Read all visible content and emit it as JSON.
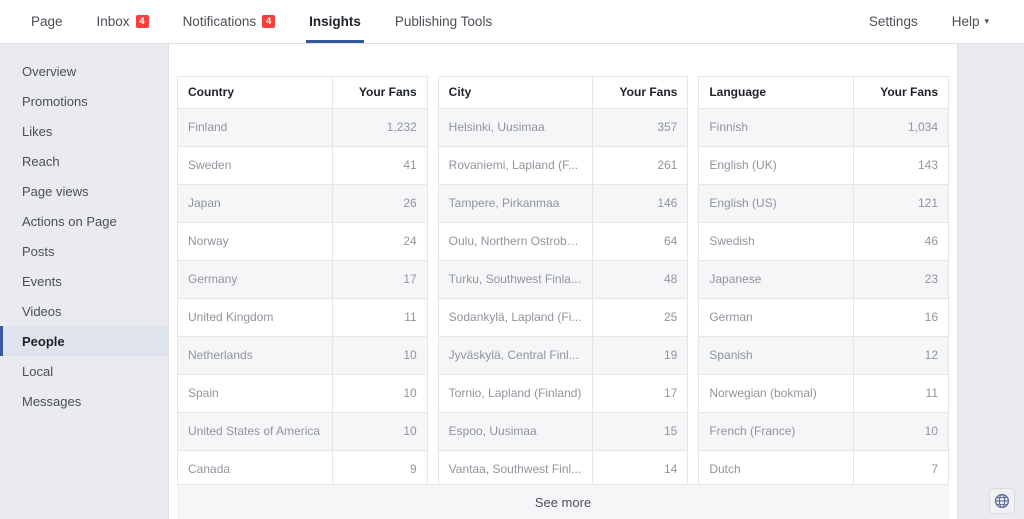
{
  "topnav": {
    "left_items": [
      {
        "label": "Page",
        "badge": null,
        "active": false,
        "caret": false
      },
      {
        "label": "Inbox",
        "badge": "4",
        "active": false,
        "caret": false
      },
      {
        "label": "Notifications",
        "badge": "4",
        "active": false,
        "caret": false
      },
      {
        "label": "Insights",
        "badge": null,
        "active": true,
        "caret": false
      },
      {
        "label": "Publishing Tools",
        "badge": null,
        "active": false,
        "caret": false
      }
    ],
    "right_items": [
      {
        "label": "Settings",
        "badge": null,
        "active": false,
        "caret": false
      },
      {
        "label": "Help",
        "badge": null,
        "active": false,
        "caret": true
      }
    ],
    "accent_color": "#365899",
    "badge_color": "#fa3e3e"
  },
  "sidebar": {
    "items": [
      {
        "label": "Overview",
        "selected": false
      },
      {
        "label": "Promotions",
        "selected": false
      },
      {
        "label": "Likes",
        "selected": false
      },
      {
        "label": "Reach",
        "selected": false
      },
      {
        "label": "Page views",
        "selected": false
      },
      {
        "label": "Actions on Page",
        "selected": false
      },
      {
        "label": "Posts",
        "selected": false
      },
      {
        "label": "Events",
        "selected": false
      },
      {
        "label": "Videos",
        "selected": false
      },
      {
        "label": "People",
        "selected": true
      },
      {
        "label": "Local",
        "selected": false
      },
      {
        "label": "Messages",
        "selected": false
      }
    ],
    "selected_marker_color": "#3b5998",
    "selected_bg_color": "#dfe3ee"
  },
  "tables": [
    {
      "id": "country",
      "headers": [
        "Country",
        "Your Fans"
      ],
      "rows": [
        [
          "Finland",
          "1,232"
        ],
        [
          "Sweden",
          "41"
        ],
        [
          "Japan",
          "26"
        ],
        [
          "Norway",
          "24"
        ],
        [
          "Germany",
          "17"
        ],
        [
          "United Kingdom",
          "11"
        ],
        [
          "Netherlands",
          "10"
        ],
        [
          "Spain",
          "10"
        ],
        [
          "United States of America",
          "10"
        ],
        [
          "Canada",
          "9"
        ]
      ]
    },
    {
      "id": "city",
      "headers": [
        "City",
        "Your Fans"
      ],
      "rows": [
        [
          "Helsinki, Uusimaa",
          "357"
        ],
        [
          "Rovaniemi, Lapland (F...",
          "261"
        ],
        [
          "Tampere, Pirkanmaa",
          "146"
        ],
        [
          "Oulu, Northern Ostrobo...",
          "64"
        ],
        [
          "Turku, Southwest Finla...",
          "48"
        ],
        [
          "Sodankylä, Lapland (Fi...",
          "25"
        ],
        [
          "Jyväskylä, Central Finl...",
          "19"
        ],
        [
          "Tornio, Lapland (Finland)",
          "17"
        ],
        [
          "Espoo, Uusimaa",
          "15"
        ],
        [
          "Vantaa, Southwest Finl...",
          "14"
        ]
      ]
    },
    {
      "id": "language",
      "headers": [
        "Language",
        "Your Fans"
      ],
      "rows": [
        [
          "Finnish",
          "1,034"
        ],
        [
          "English (UK)",
          "143"
        ],
        [
          "English (US)",
          "121"
        ],
        [
          "Swedish",
          "46"
        ],
        [
          "Japanese",
          "23"
        ],
        [
          "German",
          "16"
        ],
        [
          "Spanish",
          "12"
        ],
        [
          "Norwegian (bokmal)",
          "11"
        ],
        [
          "French (France)",
          "10"
        ],
        [
          "Dutch",
          "7"
        ]
      ]
    }
  ],
  "footer": {
    "see_more_label": "See more"
  },
  "right_rail": {
    "globe_icon": "globe-icon"
  }
}
